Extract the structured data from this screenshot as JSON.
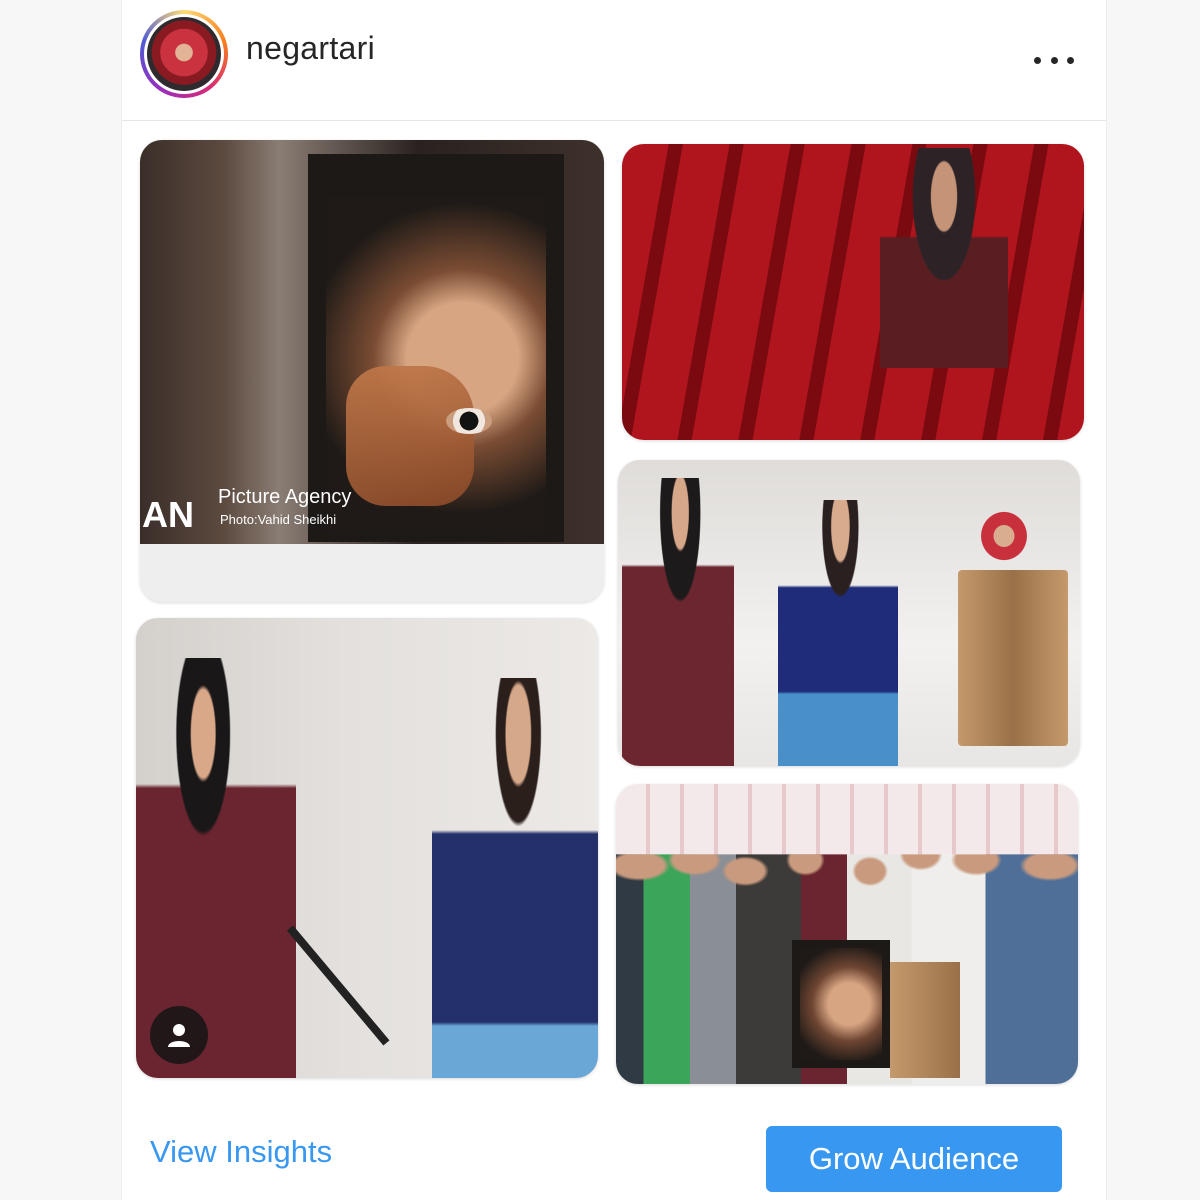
{
  "post": {
    "username": "negartari",
    "more_icon": "more-horizontal-icon",
    "photo_credit": {
      "agency_fragment": "AN",
      "agency_line": "Picture Agency",
      "photographer_line": "Photo:Vahid Sheikhi"
    }
  },
  "actions": {
    "view_insights": "View Insights",
    "grow_audience": "Grow Audience"
  },
  "colors": {
    "accent": "#3897f0",
    "text": "#262626"
  }
}
